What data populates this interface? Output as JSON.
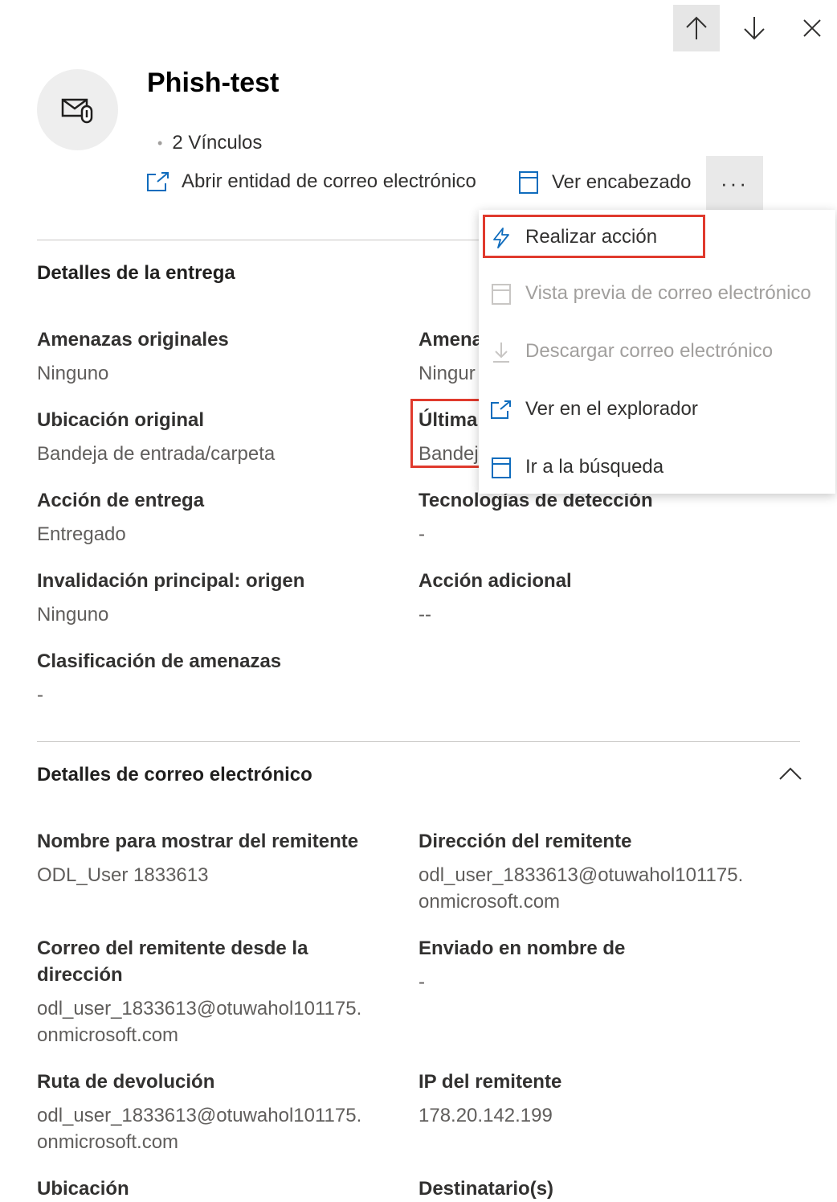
{
  "panel": {
    "title": "Phish-test",
    "links": "2 Vínculos",
    "actions": {
      "open_entity": "Abrir entidad de correo electrónico",
      "view_header": "Ver encabezado",
      "more": "···"
    }
  },
  "dropdown_menu": {
    "items": [
      {
        "label": "Realizar acción",
        "icon": "lightning-icon",
        "enabled": true
      },
      {
        "label": "Vista previa de correo electrónico",
        "icon": "preview-icon",
        "enabled": false
      },
      {
        "label": "Descargar correo electrónico",
        "icon": "download-icon",
        "enabled": false
      },
      {
        "label": "Ver en el explorador",
        "icon": "open-external-icon",
        "enabled": true
      },
      {
        "label": "Ir a la búsqueda",
        "icon": "window-icon",
        "enabled": true
      }
    ]
  },
  "delivery_details": {
    "title": "Detalles de la entrega",
    "fields": [
      {
        "label": "Amenazas originales",
        "value": "Ninguno"
      },
      {
        "label": "Amena",
        "value": "Ningur"
      },
      {
        "label": "Ubicación original",
        "value": "Bandeja de entrada/carpeta"
      },
      {
        "label": "Última",
        "value": "Bandej"
      },
      {
        "label": "Acción de entrega",
        "value": "Entregado"
      },
      {
        "label": "Tecnologías de detección",
        "value": "-"
      },
      {
        "label": "Invalidación principal: origen",
        "value": "Ninguno"
      },
      {
        "label": "Acción adicional",
        "value": "--"
      },
      {
        "label": "Clasificación de amenazas",
        "value": "-"
      }
    ]
  },
  "email_details": {
    "title": "Detalles de correo electrónico",
    "fields": [
      {
        "label": "Nombre para mostrar del remitente",
        "value": "ODL_User 1833613"
      },
      {
        "label": "Dirección del remitente",
        "value": "odl_user_1833613@otuwahol101175.",
        "value2": "onmicrosoft.com"
      },
      {
        "label": "Correo del remitente desde la",
        "label2": "dirección",
        "value": "odl_user_1833613@otuwahol101175.",
        "value2": "onmicrosoft.com"
      },
      {
        "label": "Enviado en nombre de",
        "value": "-"
      },
      {
        "label": "Ruta de devolución",
        "value": "odl_user_1833613@otuwahol101175.",
        "value2": "onmicrosoft.com"
      },
      {
        "label": "IP del remitente",
        "value": "178.20.142.199"
      },
      {
        "label": "Ubicación",
        "value": ""
      },
      {
        "label": "Destinatario(s)",
        "value": ""
      }
    ]
  },
  "colors": {
    "highlight": "#e03a2d",
    "accent_icon": "#0f6cbd",
    "muted_text": "#605e5c"
  }
}
